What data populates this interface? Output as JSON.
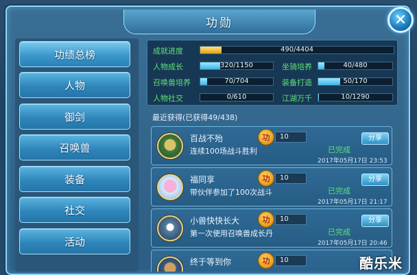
{
  "window": {
    "title": "功勋",
    "close_symbol": "✕"
  },
  "sidebar": {
    "items": [
      {
        "label": "功绩总榜"
      },
      {
        "label": "人物"
      },
      {
        "label": "御剑"
      },
      {
        "label": "召唤兽"
      },
      {
        "label": "装备"
      },
      {
        "label": "社交"
      },
      {
        "label": "活动"
      }
    ]
  },
  "stats": {
    "progress": {
      "label": "成就进度",
      "value": "490/4404",
      "fraction": 0.111
    },
    "rows": [
      {
        "label": "人物成长",
        "value": "320/1150",
        "fraction": 0.278
      },
      {
        "label": "坐骑培养",
        "value": "40/480",
        "fraction": 0.083
      },
      {
        "label": "召唤兽培养",
        "value": "70/704",
        "fraction": 0.099
      },
      {
        "label": "装备打造",
        "value": "50/170",
        "fraction": 0.294
      },
      {
        "label": "人物社交",
        "value": "0/610",
        "fraction": 0.0
      },
      {
        "label": "江湖万千",
        "value": "10/1290",
        "fraction": 0.008
      }
    ]
  },
  "recent": {
    "title": "最近获得(已获得49/438)",
    "items": [
      {
        "name": "百战不殆",
        "desc": "连续100场战斗胜利",
        "points": "10",
        "status": "已完成",
        "share": "分享",
        "time": "2017年05月17日  23:53",
        "medal": "功"
      },
      {
        "name": "福同享",
        "desc": "带伙伴参加了100次战斗",
        "points": "10",
        "status": "已完成",
        "share": "分享",
        "time": "2017年05月17日  21:17",
        "medal": "功"
      },
      {
        "name": "小兽快快长大",
        "desc": "第一次使用召唤兽成长丹",
        "points": "10",
        "status": "已完成",
        "share": "分享",
        "time": "2017年05月17日  20:46",
        "medal": "功"
      },
      {
        "name": "终于等到你",
        "desc": "",
        "points": "10",
        "status": "",
        "share": "",
        "time": "",
        "medal": "功"
      }
    ]
  },
  "watermark": "酷乐米"
}
